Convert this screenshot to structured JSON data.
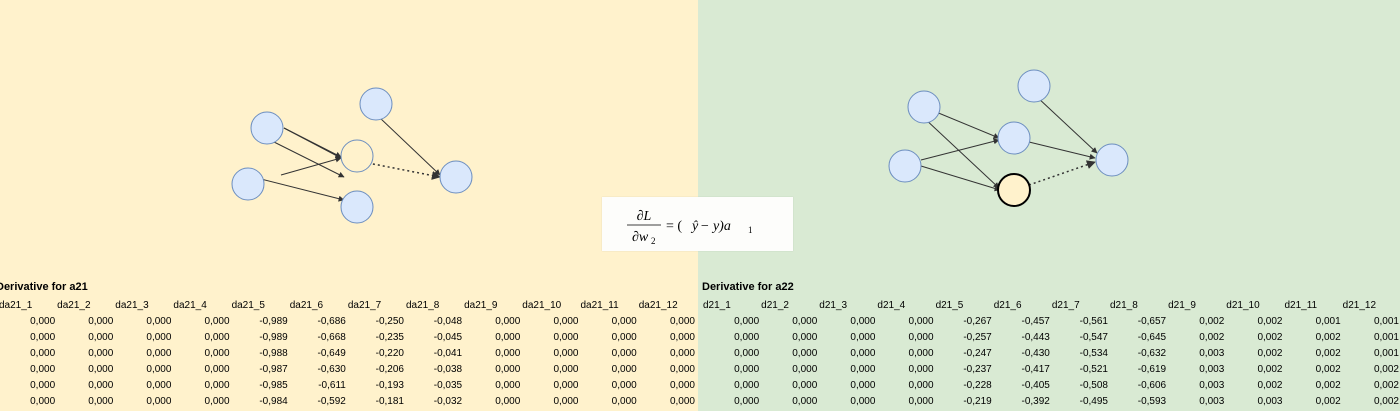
{
  "colors": {
    "left_panel": "#fff2cc",
    "right_panel": "#d9ead3",
    "node_fill": "#dae8fc",
    "highlight_fill": "#fff2cc",
    "edge": "#333333"
  },
  "formula": {
    "numerator": "∂L",
    "denominator": "∂w",
    "denominator_sub": "2",
    "rhs_prefix": "= (",
    "rhs_y_hat": "ŷ",
    "rhs_mid": " − y)a",
    "rhs_sub": "1"
  },
  "left_table": {
    "title": "Derivative for a21",
    "headers": [
      "da21_1",
      "da21_2",
      "da21_3",
      "da21_4",
      "da21_5",
      "da21_6",
      "da21_7",
      "da21_8",
      "da21_9",
      "da21_10",
      "da21_11",
      "da21_12"
    ],
    "rows": [
      [
        "0,000",
        "0,000",
        "0,000",
        "0,000",
        "-0,989",
        "-0,686",
        "-0,250",
        "-0,048",
        "0,000",
        "0,000",
        "0,000",
        "0,000"
      ],
      [
        "0,000",
        "0,000",
        "0,000",
        "0,000",
        "-0,989",
        "-0,668",
        "-0,235",
        "-0,045",
        "0,000",
        "0,000",
        "0,000",
        "0,000"
      ],
      [
        "0,000",
        "0,000",
        "0,000",
        "0,000",
        "-0,988",
        "-0,649",
        "-0,220",
        "-0,041",
        "0,000",
        "0,000",
        "0,000",
        "0,000"
      ],
      [
        "0,000",
        "0,000",
        "0,000",
        "0,000",
        "-0,987",
        "-0,630",
        "-0,206",
        "-0,038",
        "0,000",
        "0,000",
        "0,000",
        "0,000"
      ],
      [
        "0,000",
        "0,000",
        "0,000",
        "0,000",
        "-0,985",
        "-0,611",
        "-0,193",
        "-0,035",
        "0,000",
        "0,000",
        "0,000",
        "0,000"
      ],
      [
        "0,000",
        "0,000",
        "0,000",
        "0,000",
        "-0,984",
        "-0,592",
        "-0,181",
        "-0,032",
        "0,000",
        "0,000",
        "0,000",
        "0,000"
      ]
    ]
  },
  "right_table": {
    "title": "Derivative for a22",
    "headers": [
      "d21_1",
      "d21_2",
      "d21_3",
      "d21_4",
      "d21_5",
      "d21_6",
      "d21_7",
      "d21_8",
      "d21_9",
      "d21_10",
      "d21_11",
      "d21_12"
    ],
    "rows": [
      [
        "0,000",
        "0,000",
        "0,000",
        "0,000",
        "-0,267",
        "-0,457",
        "-0,561",
        "-0,657",
        "0,002",
        "0,002",
        "0,001",
        "0,001"
      ],
      [
        "0,000",
        "0,000",
        "0,000",
        "0,000",
        "-0,257",
        "-0,443",
        "-0,547",
        "-0,645",
        "0,002",
        "0,002",
        "0,002",
        "0,001"
      ],
      [
        "0,000",
        "0,000",
        "0,000",
        "0,000",
        "-0,247",
        "-0,430",
        "-0,534",
        "-0,632",
        "0,003",
        "0,002",
        "0,002",
        "0,001"
      ],
      [
        "0,000",
        "0,000",
        "0,000",
        "0,000",
        "-0,237",
        "-0,417",
        "-0,521",
        "-0,619",
        "0,003",
        "0,002",
        "0,002",
        "0,002"
      ],
      [
        "0,000",
        "0,000",
        "0,000",
        "0,000",
        "-0,228",
        "-0,405",
        "-0,508",
        "-0,606",
        "0,003",
        "0,002",
        "0,002",
        "0,002"
      ],
      [
        "0,000",
        "0,000",
        "0,000",
        "0,000",
        "-0,219",
        "-0,392",
        "-0,495",
        "-0,593",
        "0,003",
        "0,003",
        "0,002",
        "0,002"
      ]
    ]
  }
}
